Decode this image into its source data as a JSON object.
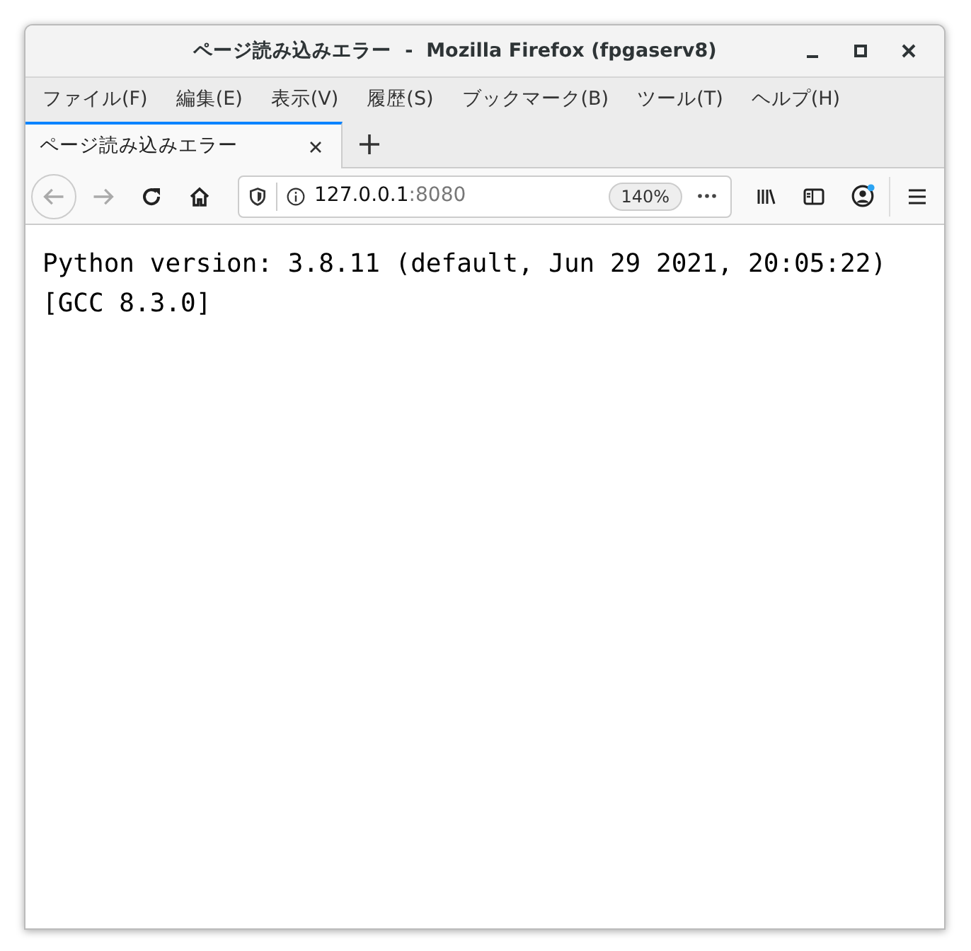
{
  "window": {
    "title": "ページ読み込みエラー  -  Mozilla Firefox (fpgaserv8)"
  },
  "menu": [
    "ファイル(F)",
    "編集(E)",
    "表示(V)",
    "履歴(S)",
    "ブックマーク(B)",
    "ツール(T)",
    "ヘルプ(H)"
  ],
  "tabs": [
    {
      "label": "ページ読み込みエラー",
      "selected": true
    }
  ],
  "address": {
    "host": "127.0.0.1",
    "port": ":8080",
    "zoom": "140%"
  },
  "nav": {
    "back_disabled": true,
    "forward_disabled": true
  },
  "account_notification": true,
  "content": [
    "Python version: 3.8.11 (default, Jun 29 2021, 20:05:22)",
    "[GCC 8.3.0]"
  ]
}
